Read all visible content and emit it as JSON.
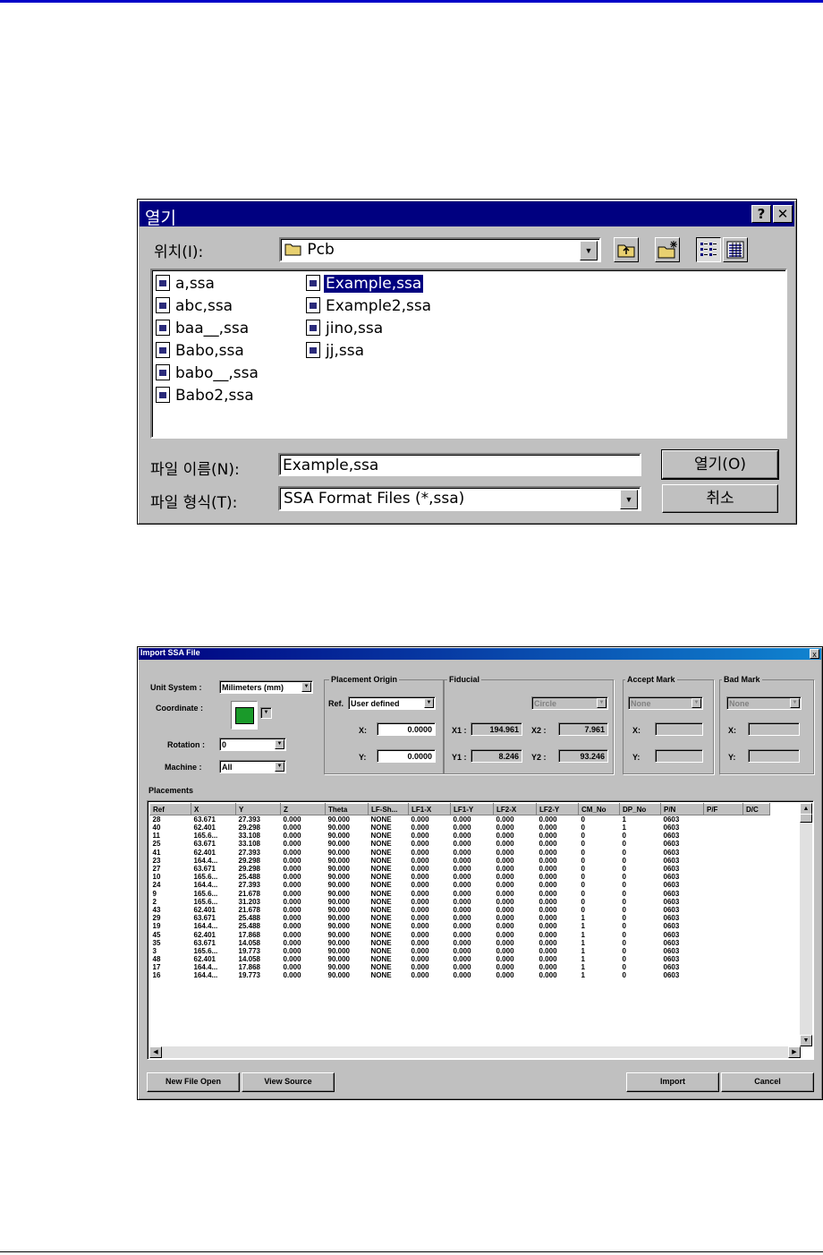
{
  "open_dialog": {
    "title": "열기",
    "help_label": "?",
    "close_label": "✕",
    "location_label": "위치(I):",
    "location_value": "Pcb",
    "files_col1": [
      "a,ssa",
      "abc,ssa",
      "baa__,ssa",
      "Babo,ssa",
      "babo__,ssa",
      "Babo2,ssa"
    ],
    "files_col2": [
      "Example,ssa",
      "Example2,ssa",
      "jino,ssa",
      "jj,ssa"
    ],
    "selected_file": "Example,ssa",
    "filename_label": "파일 이름(N):",
    "filename_value": "Example,ssa",
    "filetype_label": "파일 형식(T):",
    "filetype_value": "SSA Format Files (*,ssa)",
    "open_button": "열기(O)",
    "cancel_button": "취소"
  },
  "import_dialog": {
    "title": "Import SSA File",
    "close_label": "x",
    "unit_system_label": "Unit System :",
    "unit_system_value": "Milimeters (mm)",
    "coordinate_label": "Coordinate :",
    "rotation_label": "Rotation :",
    "rotation_value": "0",
    "machine_label": "Machine :",
    "machine_value": "All",
    "placement_origin_label": "Placement Origin",
    "ref_label": "Ref.",
    "ref_value": "User defined",
    "origin_x_label": "X:",
    "origin_x_value": "0.0000",
    "origin_y_label": "Y:",
    "origin_y_value": "0.0000",
    "fiducial_label": "Fiducial",
    "fiducial_shape": "Circle",
    "x1_label": "X1 :",
    "x1_value": "194.961",
    "x2_label": "X2 :",
    "x2_value": "7.961",
    "y1_label": "Y1 :",
    "y1_value": "8.246",
    "y2_label": "Y2 :",
    "y2_value": "93.246",
    "accept_mark_label": "Accept Mark",
    "accept_mark_value": "None",
    "am_x_label": "X:",
    "am_y_label": "Y:",
    "bad_mark_label": "Bad Mark",
    "bad_mark_value": "None",
    "bm_x_label": "X:",
    "bm_y_label": "Y:",
    "placements_label": "Placements",
    "columns": [
      "Ref",
      "X",
      "Y",
      "Z",
      "Theta",
      "LF-Sh...",
      "LF1-X",
      "LF1-Y",
      "LF2-X",
      "LF2-Y",
      "CM_No",
      "DP_No",
      "P/N",
      "P/F",
      "D/C"
    ],
    "rows": [
      [
        "28",
        "63.671",
        "27.393",
        "0.000",
        "90.000",
        "NONE",
        "0.000",
        "0.000",
        "0.000",
        "0.000",
        "0",
        "1",
        "0603",
        "",
        ""
      ],
      [
        "40",
        "62.401",
        "29.298",
        "0.000",
        "90.000",
        "NONE",
        "0.000",
        "0.000",
        "0.000",
        "0.000",
        "0",
        "1",
        "0603",
        "",
        ""
      ],
      [
        "11",
        "165.6...",
        "33.108",
        "0.000",
        "90.000",
        "NONE",
        "0.000",
        "0.000",
        "0.000",
        "0.000",
        "0",
        "0",
        "0603",
        "",
        ""
      ],
      [
        "25",
        "63.671",
        "33.108",
        "0.000",
        "90.000",
        "NONE",
        "0.000",
        "0.000",
        "0.000",
        "0.000",
        "0",
        "0",
        "0603",
        "",
        ""
      ],
      [
        "41",
        "62.401",
        "27.393",
        "0.000",
        "90.000",
        "NONE",
        "0.000",
        "0.000",
        "0.000",
        "0.000",
        "0",
        "0",
        "0603",
        "",
        ""
      ],
      [
        "23",
        "164.4...",
        "29.298",
        "0.000",
        "90.000",
        "NONE",
        "0.000",
        "0.000",
        "0.000",
        "0.000",
        "0",
        "0",
        "0603",
        "",
        ""
      ],
      [
        "27",
        "63.671",
        "29.298",
        "0.000",
        "90.000",
        "NONE",
        "0.000",
        "0.000",
        "0.000",
        "0.000",
        "0",
        "0",
        "0603",
        "",
        ""
      ],
      [
        "10",
        "165.6...",
        "25.488",
        "0.000",
        "90.000",
        "NONE",
        "0.000",
        "0.000",
        "0.000",
        "0.000",
        "0",
        "0",
        "0603",
        "",
        ""
      ],
      [
        "24",
        "164.4...",
        "27.393",
        "0.000",
        "90.000",
        "NONE",
        "0.000",
        "0.000",
        "0.000",
        "0.000",
        "0",
        "0",
        "0603",
        "",
        ""
      ],
      [
        "9",
        "165.6...",
        "21.678",
        "0.000",
        "90.000",
        "NONE",
        "0.000",
        "0.000",
        "0.000",
        "0.000",
        "0",
        "0",
        "0603",
        "",
        ""
      ],
      [
        "2",
        "165.6...",
        "31.203",
        "0.000",
        "90.000",
        "NONE",
        "0.000",
        "0.000",
        "0.000",
        "0.000",
        "0",
        "0",
        "0603",
        "",
        ""
      ],
      [
        "43",
        "62.401",
        "21.678",
        "0.000",
        "90.000",
        "NONE",
        "0.000",
        "0.000",
        "0.000",
        "0.000",
        "0",
        "0",
        "0603",
        "",
        ""
      ],
      [
        "29",
        "63.671",
        "25.488",
        "0.000",
        "90.000",
        "NONE",
        "0.000",
        "0.000",
        "0.000",
        "0.000",
        "1",
        "0",
        "0603",
        "",
        ""
      ],
      [
        "19",
        "164.4...",
        "25.488",
        "0.000",
        "90.000",
        "NONE",
        "0.000",
        "0.000",
        "0.000",
        "0.000",
        "1",
        "0",
        "0603",
        "",
        ""
      ],
      [
        "45",
        "62.401",
        "17.868",
        "0.000",
        "90.000",
        "NONE",
        "0.000",
        "0.000",
        "0.000",
        "0.000",
        "1",
        "0",
        "0603",
        "",
        ""
      ],
      [
        "35",
        "63.671",
        "14.058",
        "0.000",
        "90.000",
        "NONE",
        "0.000",
        "0.000",
        "0.000",
        "0.000",
        "1",
        "0",
        "0603",
        "",
        ""
      ],
      [
        "3",
        "165.6...",
        "19.773",
        "0.000",
        "90.000",
        "NONE",
        "0.000",
        "0.000",
        "0.000",
        "0.000",
        "1",
        "0",
        "0603",
        "",
        ""
      ],
      [
        "48",
        "62.401",
        "14.058",
        "0.000",
        "90.000",
        "NONE",
        "0.000",
        "0.000",
        "0.000",
        "0.000",
        "1",
        "0",
        "0603",
        "",
        ""
      ],
      [
        "17",
        "164.4...",
        "17.868",
        "0.000",
        "90.000",
        "NONE",
        "0.000",
        "0.000",
        "0.000",
        "0.000",
        "1",
        "0",
        "0603",
        "",
        ""
      ],
      [
        "16",
        "164.4...",
        "19.773",
        "0.000",
        "90.000",
        "NONE",
        "0.000",
        "0.000",
        "0.000",
        "0.000",
        "1",
        "0",
        "0603",
        "",
        ""
      ]
    ],
    "new_file_open_button": "New File Open",
    "view_source_button": "View Source",
    "import_button": "Import",
    "cancel_button": "Cancel"
  },
  "colors": {
    "title_blue": "#000080",
    "window_gray": "#c0c0c0",
    "coordinate_green": "#1a9a2a",
    "page_rule_blue": "#0000c8"
  }
}
